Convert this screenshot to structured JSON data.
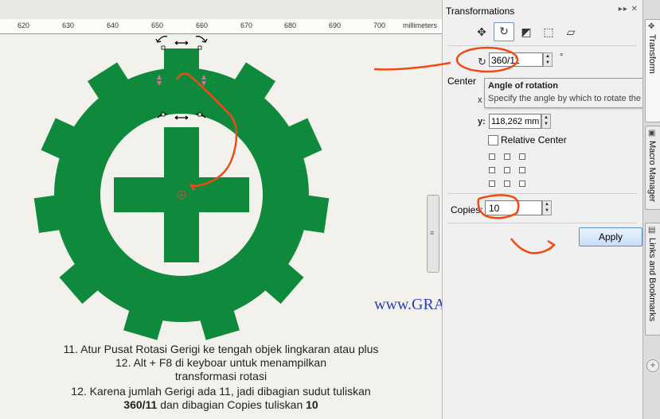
{
  "ruler": {
    "ticks": [
      "620",
      "630",
      "640",
      "650",
      "660",
      "670",
      "680",
      "690",
      "700"
    ],
    "unit": "millimeters"
  },
  "captions": {
    "line1": "11. Atur Pusat Rotasi Gerigi ke tengah objek lingkaran atau plus",
    "line2": "12. Alt + F8 di keyboar untuk menampilkan",
    "line3": "transformasi rotasi",
    "line4": "12. Karena jumlah Gerigi ada 11, jadi dibagian sudut tuliskan",
    "line5_bold1": "360/11",
    "line5_mid": " dan dibagian Copies tuliskan ",
    "line5_bold2": "10"
  },
  "watermark": "www.GRAFISIn.com",
  "docker": {
    "title": "Transformations",
    "arrows": "▸▸ ✕",
    "modes": [
      "position-icon",
      "rotate-icon",
      "scale-icon",
      "size-icon",
      "skew-icon"
    ],
    "angle_value": "360/11",
    "degree_symbol": "°",
    "center_label": "Center",
    "tooltip_title": "Angle of rotation",
    "tooltip_body": "Specify the angle by which to rotate the o",
    "x_label": "x",
    "y_label": "y:",
    "y_value": "118,262 mm",
    "relative_center_label": "Relative Center",
    "copies_label": "Copies:",
    "copies_value": "10",
    "apply_label": "Apply"
  },
  "side_tabs": {
    "tab1": "Transform",
    "tab2": "Macro Manager",
    "tab3": "Links and Bookmarks",
    "add": "+"
  },
  "colors": {
    "gear_green": "#0f8a3c",
    "annotation_orange": "#f04a14",
    "watermark_blue": "#2a3fb0"
  }
}
